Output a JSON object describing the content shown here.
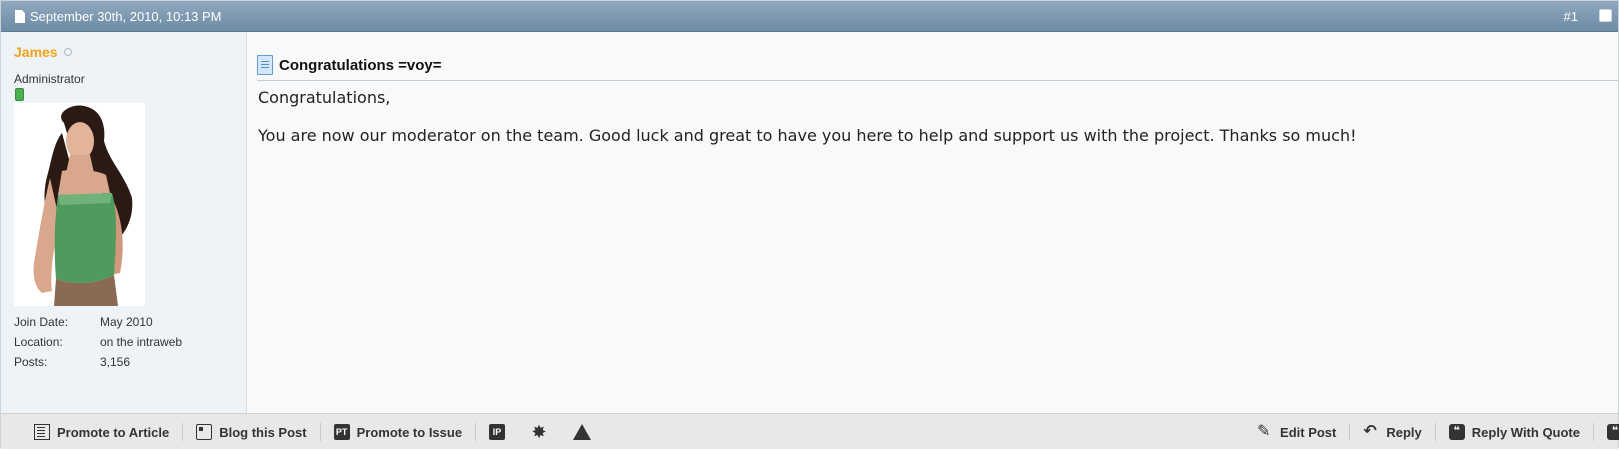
{
  "post": {
    "date": "September 30th, 2010, 10:13 PM",
    "number": "#1",
    "user": {
      "name": "James",
      "title": "Administrator",
      "stats": [
        {
          "label": "Join Date:",
          "value": "May 2010"
        },
        {
          "label": "Location:",
          "value": "on the intraweb"
        },
        {
          "label": "Posts:",
          "value": "3,156"
        }
      ]
    },
    "title": "Congratulations =voy=",
    "message": [
      "Congratulations,",
      "You are now our moderator on the team. Good luck and great to have you here to help and support us with the project. Thanks so much!"
    ]
  },
  "footer": {
    "left": [
      {
        "label": "Promote to Article",
        "icon": "article-icon"
      },
      {
        "label": "Blog this Post",
        "icon": "blog-icon"
      },
      {
        "label": "Promote to Issue",
        "icon": "issue-icon"
      }
    ],
    "ip_label": "IP",
    "pt_label": "PT",
    "right": [
      {
        "label": "Edit Post",
        "icon": "pencil-icon"
      },
      {
        "label": "Reply",
        "icon": "reply-icon"
      },
      {
        "label": "Reply With Quote",
        "icon": "quote-icon"
      }
    ]
  },
  "colors": {
    "header_bg": "#7f99b1",
    "username": "#f0a319",
    "sidebar_bg": "#eef3f8",
    "footer_bg": "#e8e8e8"
  }
}
